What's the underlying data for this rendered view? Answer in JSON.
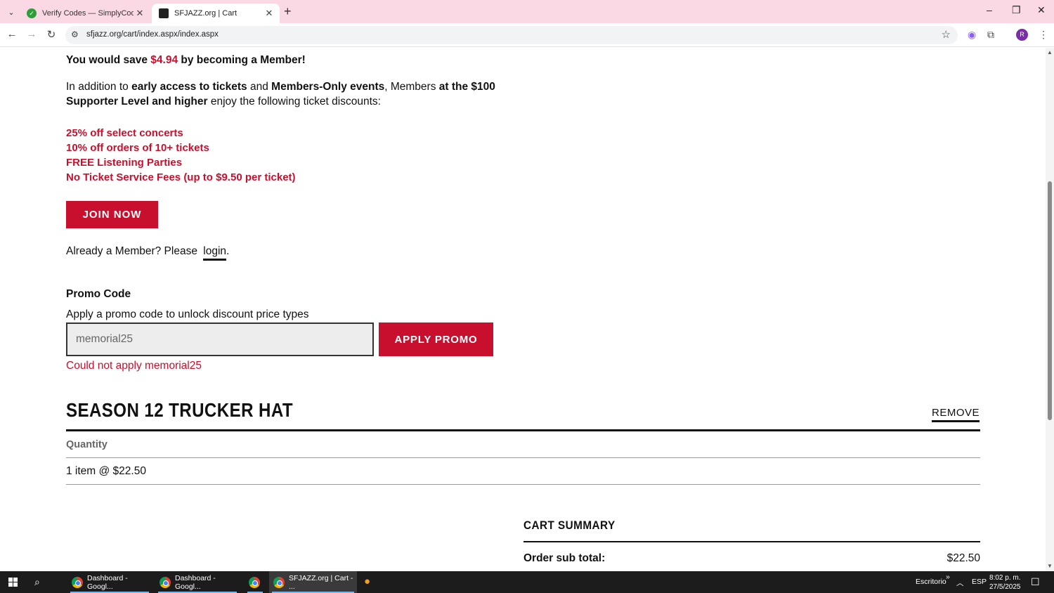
{
  "browser": {
    "tabs": [
      {
        "title": "Verify Codes — SimplyCodes",
        "active": false
      },
      {
        "title": "SFJAZZ.org | Cart",
        "active": true
      }
    ],
    "url": "sfjazz.org/cart/index.aspx/index.aspx",
    "profile_initial": "R"
  },
  "membership": {
    "save_prefix": "You would save ",
    "save_amount": "$4.94",
    "save_suffix": " by becoming a Member!",
    "intro_1": "In addition to ",
    "intro_b1": "early access to tickets",
    "intro_2": " and ",
    "intro_b2": "Members-Only events",
    "intro_3": ", Members ",
    "intro_b3": "at the $100 Supporter Level and higher",
    "intro_4": " enjoy the following ticket discounts:",
    "benefits": [
      "25% off select concerts",
      "10% off orders of 10+ tickets",
      "FREE Listening Parties",
      "No Ticket Service Fees (up to $9.50 per ticket)"
    ],
    "join_label": "JOIN NOW",
    "already_member": "Already a Member? Please ",
    "login_label": "login",
    "period": "."
  },
  "promo": {
    "title": "Promo Code",
    "subtitle": "Apply a promo code to unlock discount price types",
    "input_value": "memorial25",
    "apply_label": "APPLY PROMO",
    "error": "Could not apply memorial25"
  },
  "cart_item": {
    "title": "SEASON 12 TRUCKER HAT",
    "remove_label": "REMOVE",
    "quantity_label": "Quantity",
    "quantity_value": "1 item @ $22.50"
  },
  "summary": {
    "title": "CART SUMMARY",
    "subtotal_label": "Order sub total:",
    "subtotal_value": "$22.50"
  },
  "taskbar": {
    "items": [
      {
        "label": "Dashboard - Googl...",
        "active": false
      },
      {
        "label": "Dashboard - Googl...",
        "active": false
      },
      {
        "label": "",
        "active": false
      },
      {
        "label": "SFJAZZ.org | Cart - ...",
        "active": true
      }
    ],
    "desktop_label": "Escritorio",
    "language": "ESP",
    "time": "8:02 p. m.",
    "date": "27/5/2025"
  },
  "colors": {
    "accent": "#c8102e",
    "tab_strip": "#fbd9e4",
    "taskbar": "#1c1c1c"
  }
}
